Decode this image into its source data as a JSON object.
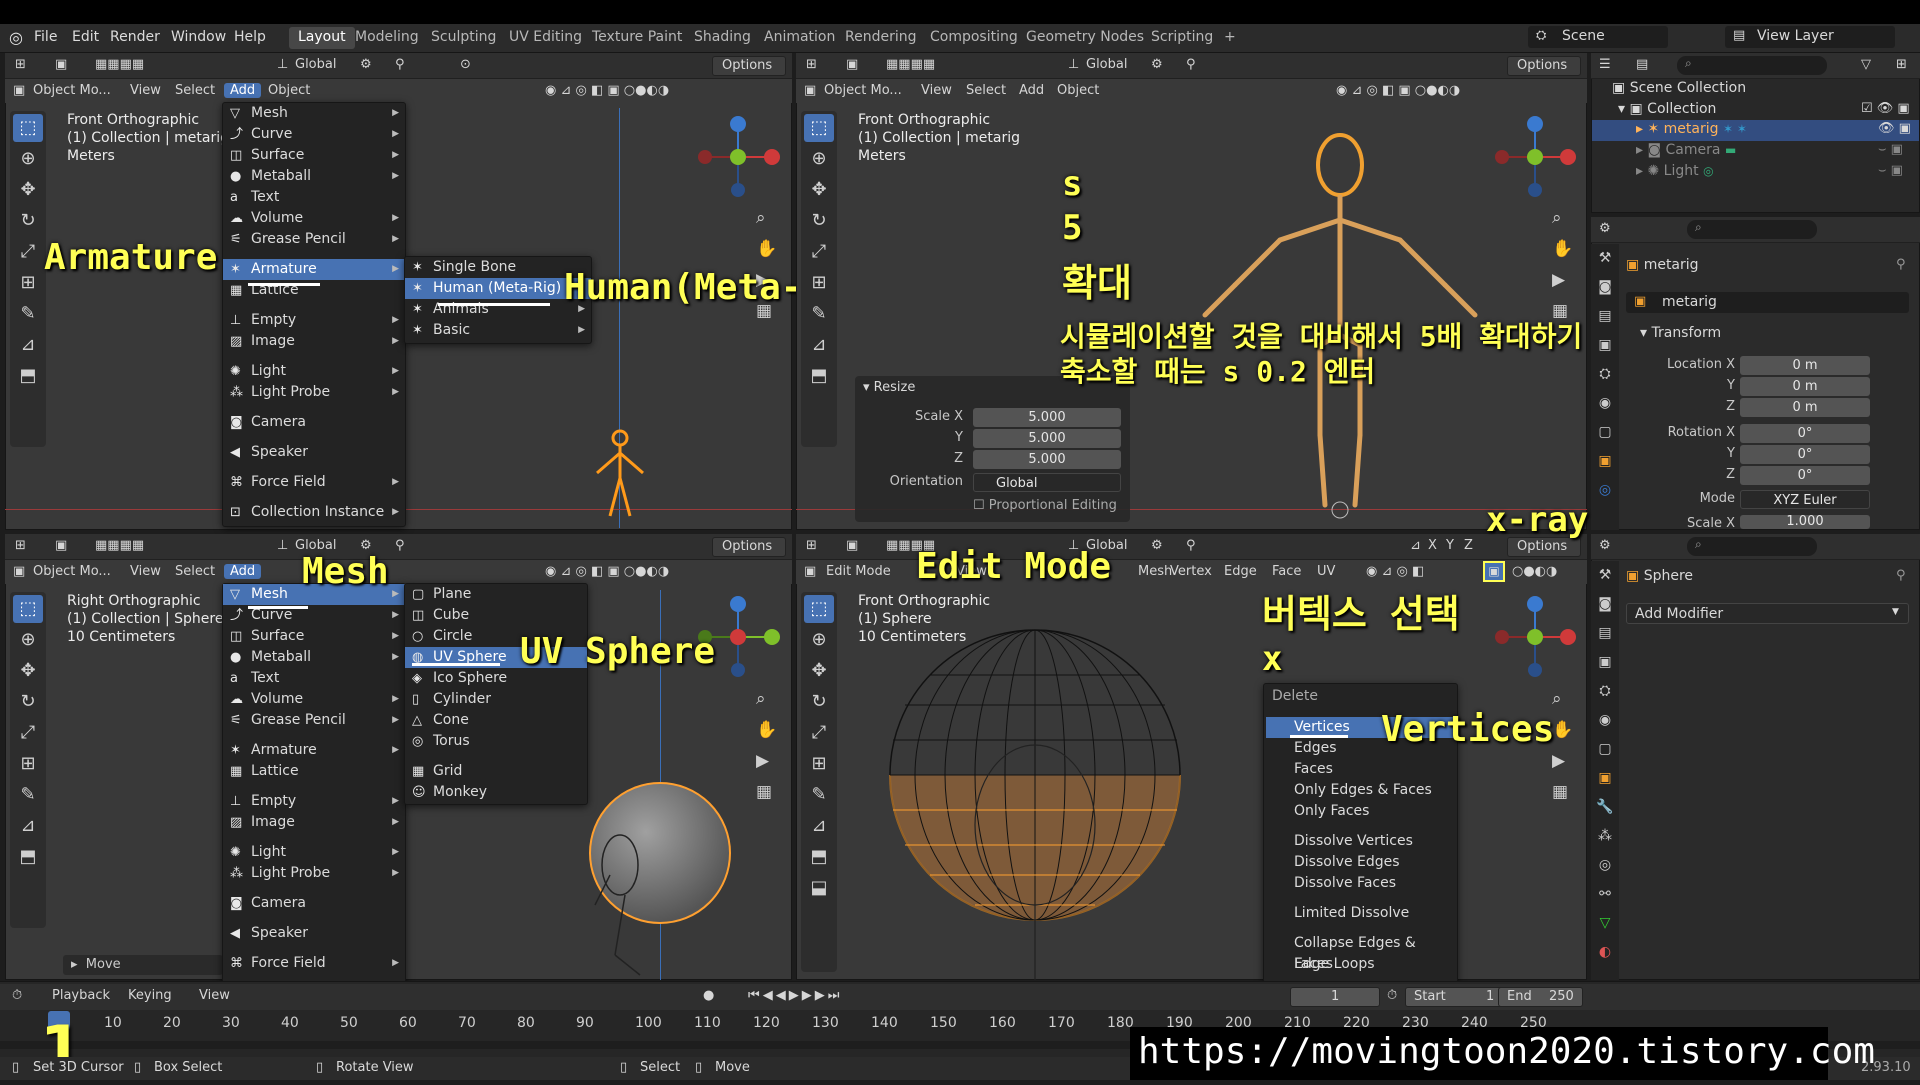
{
  "menubar": {
    "items": [
      "File",
      "Edit",
      "Render",
      "Window",
      "Help"
    ],
    "tabs": [
      "Layout",
      "Modeling",
      "Sculpting",
      "UV Editing",
      "Texture Paint",
      "Shading",
      "Animation",
      "Rendering",
      "Compositing",
      "Geometry Nodes",
      "Scripting",
      "+"
    ],
    "active_tab": "Layout",
    "scene": "Scene",
    "view_layer": "View Layer"
  },
  "hdr": {
    "global": "Global",
    "options": "Options",
    "object_mode": "Object Mo...",
    "view": "View",
    "select": "Select",
    "add": "Add",
    "object": "Object",
    "edit_mode": "Edit Mode",
    "mesh": "Mesh",
    "vertex": "Vertex",
    "edge": "Edge",
    "face": "Face",
    "uv": "UV",
    "xyz": [
      "X",
      "Y",
      "Z"
    ]
  },
  "vp_tl": {
    "line1": "Front Orthographic",
    "line2": "(1) Collection | metarig",
    "line3": "Meters"
  },
  "vp_tr": {
    "line1": "Front Orthographic",
    "line2": "(1) Collection | metarig",
    "line3": "Meters"
  },
  "vp_bl": {
    "line1": "Right Orthographic",
    "line2": "(1) Collection | Sphere",
    "line3": "10 Centimeters",
    "move": "Move"
  },
  "vp_br": {
    "line1": "Front Orthographic",
    "line2": "(1) Sphere",
    "line3": "10 Centimeters"
  },
  "add_menu": [
    "Mesh",
    "Curve",
    "Surface",
    "Metaball",
    "Text",
    "Volume",
    "Grease Pencil",
    "Armature",
    "Lattice",
    "Empty",
    "Image",
    "Light",
    "Light Probe",
    "Camera",
    "Speaker",
    "Force Field",
    "Collection Instance"
  ],
  "armature_sub": [
    "Single Bone",
    "Human (Meta-Rig)",
    "Animals",
    "Basic"
  ],
  "mesh_sub": [
    "Plane",
    "Cube",
    "Circle",
    "UV Sphere",
    "Ico Sphere",
    "Cylinder",
    "Cone",
    "Torus",
    "Grid",
    "Monkey"
  ],
  "delete_menu": {
    "title": "Delete",
    "items": [
      "Vertices",
      "Edges",
      "Faces",
      "Only Edges & Faces",
      "Only Faces",
      "Dissolve Vertices",
      "Dissolve Edges",
      "Dissolve Faces",
      "Limited Dissolve",
      "Collapse Edges & Faces",
      "Edge Loops"
    ]
  },
  "resize_panel": {
    "title": "Resize",
    "scale_x_label": "Scale X",
    "y_label": "Y",
    "z_label": "Z",
    "scale_x": "5.000",
    "scale_y": "5.000",
    "scale_z": "5.000",
    "orientation_label": "Orientation",
    "orientation": "Global",
    "prop_edit": "Proportional Editing"
  },
  "outliner": {
    "scene_collection": "Scene Collection",
    "collection": "Collection",
    "metarig": "metarig",
    "camera": "Camera",
    "light": "Light"
  },
  "props": {
    "object_name": "metarig",
    "data_name": "metarig",
    "transform": "Transform",
    "location_x_label": "Location X",
    "y": "Y",
    "z": "Z",
    "rotation_x_label": "Rotation X",
    "loc": [
      "0 m",
      "0 m",
      "0 m"
    ],
    "rot": [
      "0°",
      "0°",
      "0°"
    ],
    "mode_label": "Mode",
    "mode": "XYZ Euler",
    "scale_x_label": "Scale X",
    "scale_x": "1.000"
  },
  "modifier": {
    "object": "Sphere",
    "add_modifier": "Add Modifier"
  },
  "timeline": {
    "playback": "Playback",
    "keying": "Keying",
    "view": "View",
    "frame": "1",
    "start_label": "Start",
    "start": "1",
    "end_label": "End",
    "end": "250",
    "ticks": [
      "10",
      "20",
      "30",
      "40",
      "50",
      "60",
      "70",
      "80",
      "90",
      "100",
      "110",
      "120",
      "130",
      "140",
      "150",
      "160",
      "170",
      "180",
      "190",
      "200",
      "210",
      "220",
      "230",
      "240",
      "250"
    ]
  },
  "statusbar": {
    "set_cursor": "Set 3D Cursor",
    "box_select": "Box Select",
    "rotate_view": "Rotate View",
    "select": "Select",
    "move": "Move",
    "version": "2.93.10"
  },
  "annotations": {
    "armature": "Armature",
    "human": "Human(Meta-Rig)",
    "s": "s",
    "five": "5",
    "enlarge": "확대",
    "note1": "시뮬레이션할 것을 대비해서 5배 확대하기",
    "note2": "축소할 때는 s 0.2 엔터",
    "mesh": "Mesh",
    "uvsphere": "UV Sphere",
    "editmode": "Edit Mode",
    "xray": "x-ray",
    "vertsel": "버텍스 선택",
    "x": "x",
    "vertices": "Vertices",
    "one": "1",
    "url": "https://movingtoon2020.tistory.com"
  },
  "colors": {
    "accent": "#4772b3",
    "annotation": "#ffff55",
    "selected_orange": "#ffa030"
  }
}
